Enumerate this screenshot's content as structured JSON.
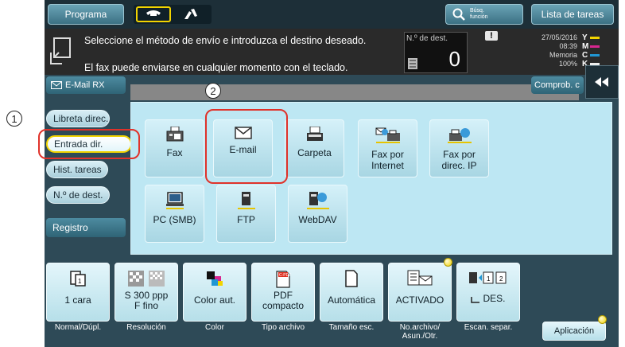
{
  "topbar": {
    "programa_label": "Programa",
    "search_label_1": "Búsq.",
    "search_label_2": "función",
    "job_list_label": "Lista de tareas"
  },
  "message": {
    "line1": "Seleccione el método de envío e introduzca el destino deseado.",
    "line2": "El fax puede enviarse en cualquier momento con el teclado.",
    "dest_label": "N.º de dest.",
    "dest_count": "0",
    "date": "27/05/2016",
    "time": "08:39",
    "memory_label": "Memoria",
    "memory_value": "100%",
    "toner_letters": [
      "Y",
      "M",
      "C",
      "K"
    ],
    "toner_colors": [
      "#f2d400",
      "#d8268f",
      "#2196d3",
      "#222222"
    ]
  },
  "email_rx_label": "E-Mail RX",
  "check_label": "Comprob. c",
  "sidebar": {
    "items": [
      {
        "label": "Libreta direc."
      },
      {
        "label": "Entrada dir."
      },
      {
        "label": "Hist. tareas"
      },
      {
        "label": "N.º de dest."
      },
      {
        "label": "Registro"
      }
    ]
  },
  "destinations": [
    {
      "label": "Fax",
      "icon": "fax-icon"
    },
    {
      "label": "E-mail",
      "icon": "envelope-icon"
    },
    {
      "label": "Carpeta",
      "icon": "folder-printer-icon"
    },
    {
      "label": "Fax por\nInternet",
      "icon": "internet-fax-icon"
    },
    {
      "label": "Fax por\ndirec. IP",
      "icon": "ip-fax-icon"
    },
    {
      "label": "PC (SMB)",
      "icon": "computer-icon"
    },
    {
      "label": "FTP",
      "icon": "ftp-icon"
    },
    {
      "label": "WebDAV",
      "icon": "webdav-icon"
    }
  ],
  "settings": [
    {
      "value": "1 cara",
      "caption": "Normal/Dúpl."
    },
    {
      "value": "S 300 ppp\nF fino",
      "caption": "Resolución"
    },
    {
      "value": "Color aut.",
      "caption": "Color"
    },
    {
      "value": "PDF\ncompacto",
      "caption": "Tipo archivo"
    },
    {
      "value": "Automática",
      "caption": "Tamaño esc."
    },
    {
      "value": "ACTIVADO",
      "caption": "No.archivo/\nAsun./Otr."
    },
    {
      "value": "DES.",
      "caption": "Escan. separ."
    }
  ],
  "app_label": "Aplicación",
  "annotations": {
    "step1": "1",
    "step2": "2"
  },
  "accent_red": "#e0322a"
}
